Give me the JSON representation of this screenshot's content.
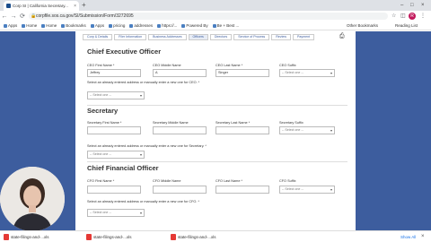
{
  "browser": {
    "tab_title": "Corp SI | California Secretary...",
    "tab_close": "×",
    "new_tab": "+",
    "url": "corpfile.sos.ca.gov/SI/Submission/Form/3272695",
    "back": "←",
    "forward": "→",
    "reload": "⟳",
    "profile_initial": "R",
    "window_minimize": "–",
    "window_maximize": "□",
    "window_close": "×"
  },
  "bookmarks": {
    "items": [
      "Apps",
      "Home",
      "Home",
      "Bookmarks",
      "Apps",
      "pricing",
      "addresses",
      "https://...",
      "Powered By",
      "Be + Best ..."
    ],
    "other": "Other Bookmarks",
    "reading": "Reading List"
  },
  "page": {
    "subtabs": [
      "Corp & Details",
      "Filer Information",
      "Business Addresses",
      "Officers",
      "Directors",
      "Service of Process",
      "Review",
      "Payment"
    ],
    "active_subtab": "Officers",
    "ceo": {
      "title": "Chief Executive Officer",
      "first_label": "CEO First Name *",
      "first_value": "Jeffrey",
      "middle_label": "CEO Middle Name",
      "middle_value": "A",
      "last_label": "CEO Last Name *",
      "last_value": "Singer",
      "suffix_label": "CEO Suffix",
      "suffix_value": "-- Select one --",
      "address_prompt": "Select an already entered address or manually enter a new one for CEO. *",
      "address_value": "-- Select one --"
    },
    "secretary": {
      "title": "Secretary",
      "first_label": "Secretary First Name *",
      "middle_label": "Secretary Middle Name",
      "last_label": "Secretary Last Name *",
      "suffix_label": "Secretary Suffix",
      "suffix_value": "-- Select one --",
      "address_prompt": "Select an already entered address or manually enter a new one for Secretary. *",
      "address_value": "-- Select one --"
    },
    "cfo": {
      "title": "Chief Financial Officer",
      "first_label": "CFO First Name *",
      "middle_label": "CFO Middle Name",
      "last_label": "CFO Last Name *",
      "suffix_label": "CFO Suffix",
      "suffix_value": "-- Select one --",
      "address_prompt": "Select an already entered address or manually enter a new one for CFO. *",
      "address_value": "-- Select one --"
    }
  },
  "downloads": {
    "items": [
      "state-filings-and-...xls",
      "state-filings-and-...xls",
      "state-filings-and-...xls"
    ],
    "show_all": "Show All",
    "close": "×"
  },
  "colors": {
    "page_background": "#3d5d9e",
    "accent": "#1a73e8"
  }
}
